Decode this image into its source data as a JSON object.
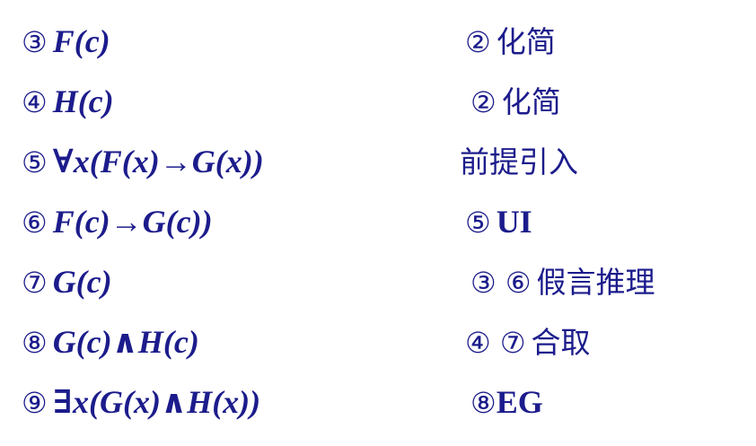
{
  "rows": [
    {
      "num": "③",
      "formula": "F(c)",
      "reason_refs": "②",
      "reason_text": "化简"
    },
    {
      "num": "④",
      "formula": "H(c)",
      "reason_refs": "②",
      "reason_text": "化简"
    },
    {
      "num": "⑤",
      "formula": "∀x(F(x)→G(x))",
      "reason_refs": "",
      "reason_text": "前提引入"
    },
    {
      "num": "⑥",
      "formula": "F(c)→G(c))",
      "reason_refs": "⑤",
      "reason_text": "UI"
    },
    {
      "num": "⑦",
      "formula": "G(c)",
      "reason_refs": "③ ⑥",
      "reason_text": "假言推理"
    },
    {
      "num": "⑧",
      "formula": "G(c)∧H(c)",
      "reason_refs": "④ ⑦",
      "reason_text": "合取"
    },
    {
      "num": "⑨",
      "formula": "∃x(G(x)∧H(x))",
      "reason_refs": "⑧",
      "reason_text": "EG"
    }
  ],
  "colors": {
    "text": "#1c1c8c",
    "background": "#ffffff"
  }
}
